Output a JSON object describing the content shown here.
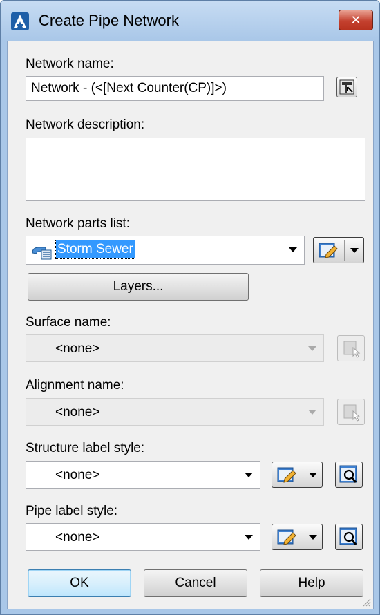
{
  "dialog": {
    "title": "Create Pipe Network",
    "close_label": "✕"
  },
  "network_name": {
    "label": "Network name:",
    "value": "Network - (<[Next Counter(CP)]>)"
  },
  "network_description": {
    "label": "Network description:",
    "value": ""
  },
  "parts_list": {
    "label": "Network parts list:",
    "value": "Storm Sewer"
  },
  "layers_button": "Layers...",
  "surface": {
    "label": "Surface name:",
    "value": "<none>"
  },
  "alignment": {
    "label": "Alignment name:",
    "value": "<none>"
  },
  "structure_label_style": {
    "label": "Structure label style:",
    "value": "<none>"
  },
  "pipe_label_style": {
    "label": "Pipe label style:",
    "value": "<none>"
  },
  "footer": {
    "ok": "OK",
    "cancel": "Cancel",
    "help": "Help"
  },
  "icons": {
    "app": "civil3d-logo-icon",
    "name_template": "name-template-icon",
    "parts_list": "parts-list-icon",
    "edit_style": "edit-style-icon",
    "pick_from_drawing": "pick-from-drawing-icon",
    "preview_style": "preview-style-icon"
  },
  "colors": {
    "titlebar": "#a9c7e8",
    "close_button": "#c4412f",
    "selection": "#3399ff",
    "default_button": "#bee6fd"
  }
}
